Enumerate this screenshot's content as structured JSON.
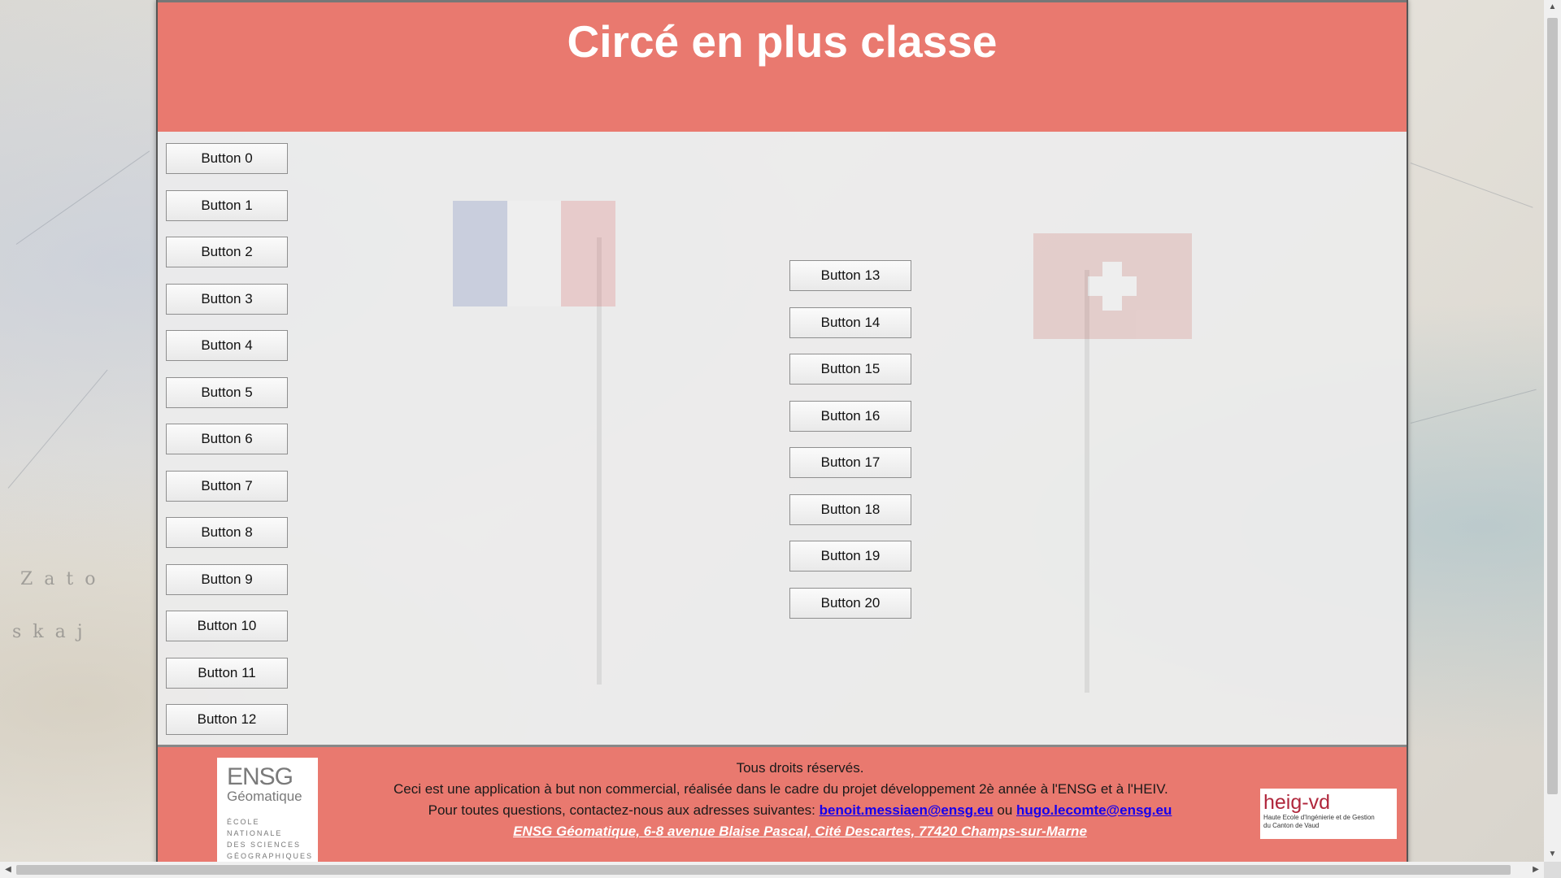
{
  "header": {
    "title": "Circé en plus classe"
  },
  "buttons_left": [
    "Button 0",
    "Button 1",
    "Button 2",
    "Button 3",
    "Button 4",
    "Button 5",
    "Button 6",
    "Button 7",
    "Button 8",
    "Button 9",
    "Button 10",
    "Button 11",
    "Button 12"
  ],
  "buttons_center": [
    "Button 13",
    "Button 14",
    "Button 15",
    "Button 16",
    "Button 17",
    "Button 18",
    "Button 19",
    "Button 20"
  ],
  "footer": {
    "rights": "Tous droits réservés.",
    "description": "Ceci est une application à but non commercial, réalisée dans le cadre du projet développement 2è année à l'ENSG et à l'HEIV.",
    "contact_prefix": "Pour toutes questions, contactez-nous aux adresses suivantes:",
    "email_1": "benoit.messiaen@ensg.eu",
    "contact_or": "ou",
    "email_2": "hugo.lecomte@ensg.eu",
    "address": "ENSG Géomatique, 6-8 avenue Blaise Pascal, Cité Descartes, 77420 Champs-sur-Marne"
  },
  "logos": {
    "ensg": {
      "name": "ENSG",
      "sub": "Géomatique",
      "lines": [
        "ÉCOLE NATIONALE",
        "DES SCIENCES",
        "GÉOGRAPHIQUES"
      ]
    },
    "heig": {
      "name": "heig-vd",
      "lines": [
        "Haute Ecole d'Ingénierie et de Gestion",
        "du Canton de Vaud"
      ]
    }
  },
  "colors": {
    "header_bg": "#e9796f",
    "footer_bg": "#e9796f",
    "link": "#1500ee"
  }
}
